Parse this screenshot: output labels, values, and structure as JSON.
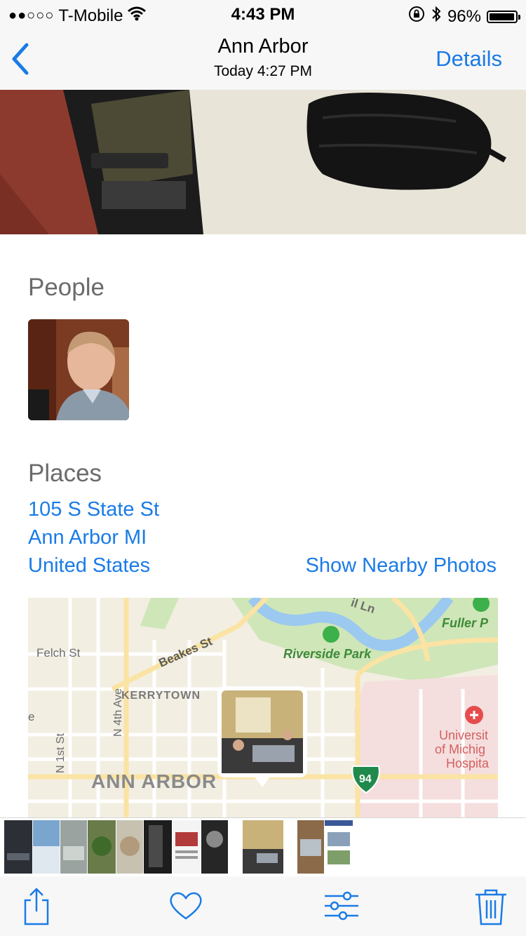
{
  "status_bar": {
    "signal": "●●○○○",
    "carrier": "T-Mobile",
    "time": "4:43 PM",
    "battery_text": "96%",
    "battery_level": 0.96,
    "icons": [
      "wifi-icon",
      "rotation-lock-icon",
      "bluetooth-icon",
      "battery-icon"
    ]
  },
  "nav": {
    "back_icon": "chevron-left-icon",
    "title": "Ann Arbor",
    "subtitle": "Today  4:27 PM",
    "details_label": "Details"
  },
  "people": {
    "heading": "People"
  },
  "places": {
    "heading": "Places",
    "address_line1": "105 S State St",
    "address_line2": "Ann Arbor MI",
    "address_line3": "United States",
    "nearby_label": "Show Nearby Photos"
  },
  "map": {
    "labels": {
      "felch": "Felch St",
      "beakes": "Beakes St",
      "riverside": "Riverside Park",
      "fuller": "Fuller P",
      "kerrytown": "KERRYTOWN",
      "n4th": "N 4th Ave",
      "n1st": "N 1st St",
      "ann_arbor": "ANN ARBOR",
      "hospital1": "Universit",
      "hospital2": "of Michig",
      "hospital3": "Hospita",
      "highway": "94",
      "top_street": "il Ln",
      "edge": "e"
    }
  },
  "colors": {
    "accent": "#1a7be6",
    "map_park": "#cfe6b8",
    "map_water": "#9cc9ef",
    "map_road": "#fbe3a4",
    "hospital_area": "#f5dede"
  },
  "toolbar": {
    "icons": [
      "share-icon",
      "heart-icon",
      "adjust-icon",
      "trash-icon"
    ]
  }
}
